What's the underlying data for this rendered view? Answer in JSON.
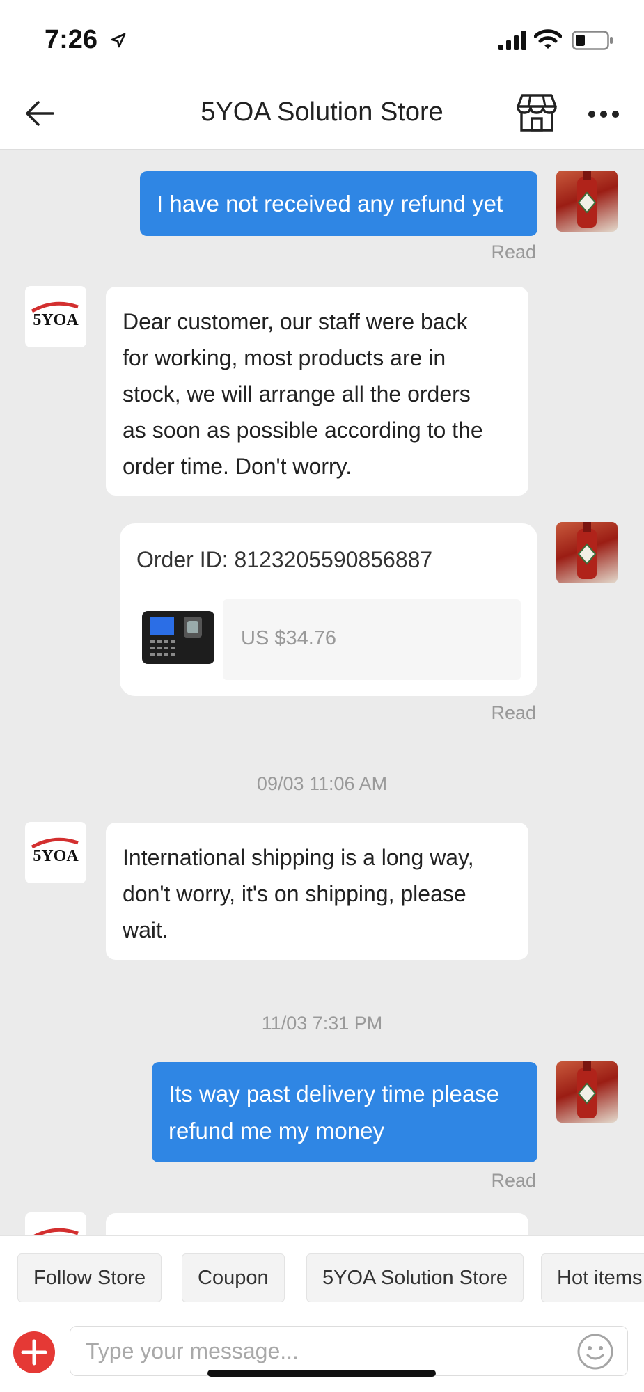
{
  "status": {
    "time": "7:26"
  },
  "header": {
    "title": "5YOA Solution Store"
  },
  "store_logo_text": "5YOA",
  "messages": {
    "m1": {
      "text": "I have not received any refund yet",
      "status": "Read"
    },
    "m2": {
      "lines": [
        "Dear customer, our staff were back",
        "for working, most products are in",
        "stock, we will arrange all the orders",
        "as soon as possible according to the",
        "order time. Don't worry."
      ]
    },
    "order": {
      "label": "Order ID: 8123205590856887",
      "price": "US $34.76",
      "status": "Read"
    },
    "stamp1": "09/03 11:06 AM",
    "m3": {
      "lines": [
        "International shipping is a long way,",
        "don't worry, it's on shipping, please",
        "wait."
      ]
    },
    "stamp2": "11/03 7:31 PM",
    "m4": {
      "lines": [
        "Its way past delivery time please",
        "refund me my money"
      ],
      "status": "Read"
    }
  },
  "quick_actions": [
    "Follow Store",
    "Coupon",
    "5YOA Solution Store",
    "Hot items"
  ],
  "composer": {
    "placeholder": "Type your message..."
  },
  "colors": {
    "accent": "#2f86e4",
    "add_button": "#e53935",
    "background": "#ebebeb"
  }
}
